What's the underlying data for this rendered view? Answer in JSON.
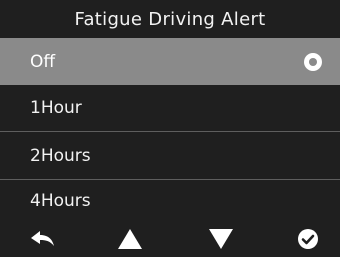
{
  "header": {
    "title": "Fatigue Driving Alert"
  },
  "options": [
    {
      "label": "Off",
      "selected": true
    },
    {
      "label": "1Hour",
      "selected": false
    },
    {
      "label": "2Hours",
      "selected": false
    },
    {
      "label": "4Hours",
      "selected": false
    }
  ],
  "nav": {
    "icons": [
      "back-icon",
      "up-arrow-icon",
      "down-arrow-icon",
      "confirm-icon"
    ]
  },
  "colors": {
    "background": "#1f1f1f",
    "selected_row": "#8a8a8a",
    "text": "#f2f2f2"
  }
}
